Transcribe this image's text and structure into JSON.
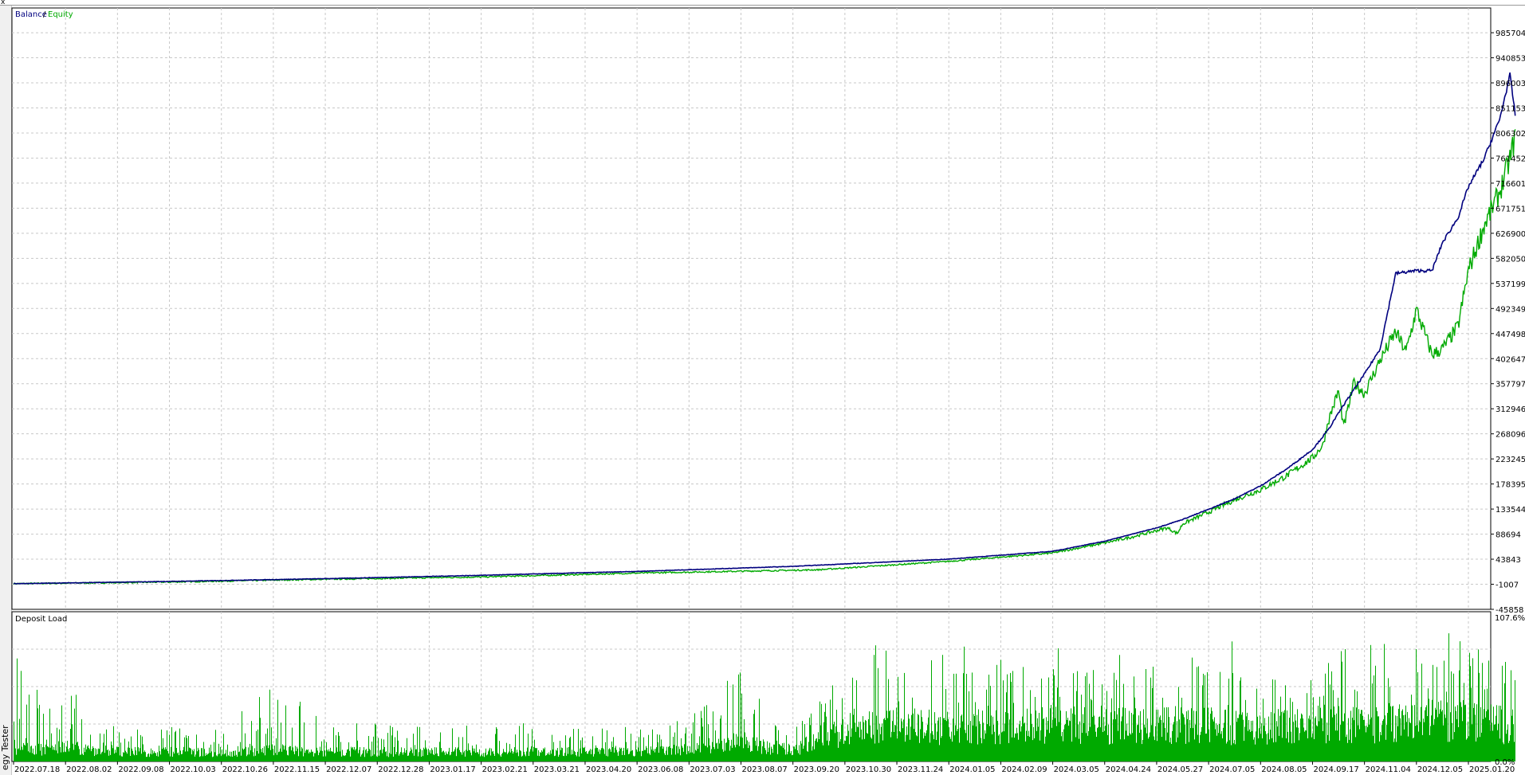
{
  "window": {
    "close_glyph": "x",
    "side_tab_label": "egy Tester"
  },
  "chart_data": [
    {
      "type": "line",
      "title": "",
      "legend": [
        "Balance",
        "Equity"
      ],
      "legend_separator": "/",
      "colors": {
        "Balance": "#00007f",
        "Equity": "#00aa00"
      },
      "grid": true,
      "ylim": [
        -45858,
        1030000
      ],
      "y_ticks": [
        "985704",
        "940853",
        "896003",
        "851153",
        "806302",
        "761452",
        "716601",
        "671751",
        "626900",
        "582050",
        "537199",
        "492349",
        "447498",
        "402647",
        "357797",
        "312946",
        "268096",
        "223245",
        "178395",
        "133544",
        "88694",
        "43843",
        "-1007",
        "-45858"
      ],
      "y_tick_values": [
        985704,
        940853,
        896003,
        851153,
        806302,
        761452,
        716601,
        671751,
        626900,
        582050,
        537199,
        492349,
        447498,
        402647,
        357797,
        312946,
        268096,
        223245,
        178395,
        133544,
        88694,
        43843,
        -1007,
        -45858
      ],
      "x_ticks": [
        "2022.07.18",
        "2022.08.02",
        "2022.09.08",
        "2022.10.03",
        "2022.10.26",
        "2022.11.15",
        "2022.12.07",
        "2022.12.28",
        "2023.01.17",
        "2023.02.21",
        "2023.03.21",
        "2023.04.20",
        "2023.06.08",
        "2023.07.03",
        "2023.08.07",
        "2023.09.20",
        "2023.10.30",
        "2023.11.24",
        "2024.01.05",
        "2024.02.09",
        "2024.03.05",
        "2024.04.24",
        "2024.05.27",
        "2024.07.05",
        "2024.08.05",
        "2024.09.17",
        "2024.11.04",
        "2024.12.05",
        "2025.01.20"
      ],
      "series": [
        {
          "name": "Balance",
          "x": [
            0,
            3,
            6,
            9,
            12,
            15,
            18,
            20,
            21,
            21.5,
            22,
            22.5,
            23,
            23.5,
            24,
            24.5,
            25,
            25.3,
            25.6,
            26,
            26.3,
            26.6,
            27,
            27.3,
            27.5,
            27.8,
            28,
            28.3,
            28.6,
            28.8,
            28.9
          ],
          "values": [
            0,
            4000,
            9000,
            15000,
            22000,
            31000,
            44000,
            58000,
            76000,
            88000,
            100000,
            115000,
            133000,
            152000,
            175000,
            205000,
            240000,
            275000,
            320000,
            375000,
            420000,
            555000,
            560000,
            560000,
            610000,
            655000,
            710000,
            760000,
            830000,
            910000,
            840000
          ]
        },
        {
          "name": "Equity",
          "x": [
            0,
            3,
            6,
            9,
            12,
            15,
            15.5,
            18,
            20,
            21,
            21.5,
            22,
            22.2,
            22.4,
            22.5,
            23,
            23.5,
            24,
            24.5,
            25,
            25.2,
            25.3,
            25.5,
            25.6,
            25.8,
            26,
            26.3,
            26.6,
            26.8,
            27,
            27.3,
            27.5,
            27.8,
            28,
            28.3,
            28.6,
            28.8,
            28.9
          ],
          "values": [
            0,
            3000,
            8000,
            12000,
            19000,
            24000,
            25000,
            40000,
            55000,
            73000,
            83000,
            95000,
            100000,
            90000,
            107000,
            128000,
            150000,
            168000,
            193000,
            225000,
            248000,
            290000,
            345000,
            280000,
            360000,
            340000,
            400000,
            450000,
            415000,
            490000,
            410000,
            420000,
            460000,
            560000,
            640000,
            700000,
            760000,
            800000
          ]
        }
      ]
    },
    {
      "type": "bar",
      "title": "Deposit Load",
      "ylim": [
        0,
        107.6
      ],
      "y_ticks": [
        "107.6%",
        "0.0%"
      ],
      "color": "#00aa00",
      "x_ticks": [
        "2022.07.18",
        "2022.08.02",
        "2022.09.08",
        "2022.10.03",
        "2022.10.26",
        "2022.11.15",
        "2022.12.07",
        "2022.12.28",
        "2023.01.17",
        "2023.02.21",
        "2023.03.21",
        "2023.04.20",
        "2023.06.08",
        "2023.07.03",
        "2023.08.07",
        "2023.09.20",
        "2023.10.30",
        "2023.11.24",
        "2024.01.05",
        "2024.02.09",
        "2024.03.05",
        "2024.04.24",
        "2024.05.27",
        "2024.07.05",
        "2024.08.05",
        "2024.09.17",
        "2024.11.04",
        "2024.12.05",
        "2025.01.20"
      ],
      "profile_x": [
        0,
        0.5,
        1,
        1.5,
        2,
        3,
        4,
        5,
        6,
        7,
        8,
        9,
        10,
        11,
        12,
        13,
        14,
        14.5,
        15,
        16,
        17,
        18,
        19,
        20,
        21,
        22,
        23,
        24,
        25,
        26,
        27,
        28,
        28.9
      ],
      "profile_peak": [
        85,
        50,
        70,
        30,
        25,
        28,
        22,
        60,
        30,
        28,
        25,
        30,
        28,
        30,
        25,
        35,
        70,
        35,
        30,
        90,
        85,
        90,
        88,
        92,
        88,
        92,
        90,
        88,
        90,
        88,
        95,
        92,
        75
      ],
      "profile_base": [
        12,
        10,
        12,
        10,
        8,
        8,
        8,
        10,
        8,
        8,
        8,
        8,
        8,
        8,
        8,
        10,
        18,
        12,
        10,
        25,
        30,
        28,
        30,
        32,
        30,
        30,
        30,
        28,
        32,
        30,
        35,
        34,
        30
      ]
    }
  ]
}
